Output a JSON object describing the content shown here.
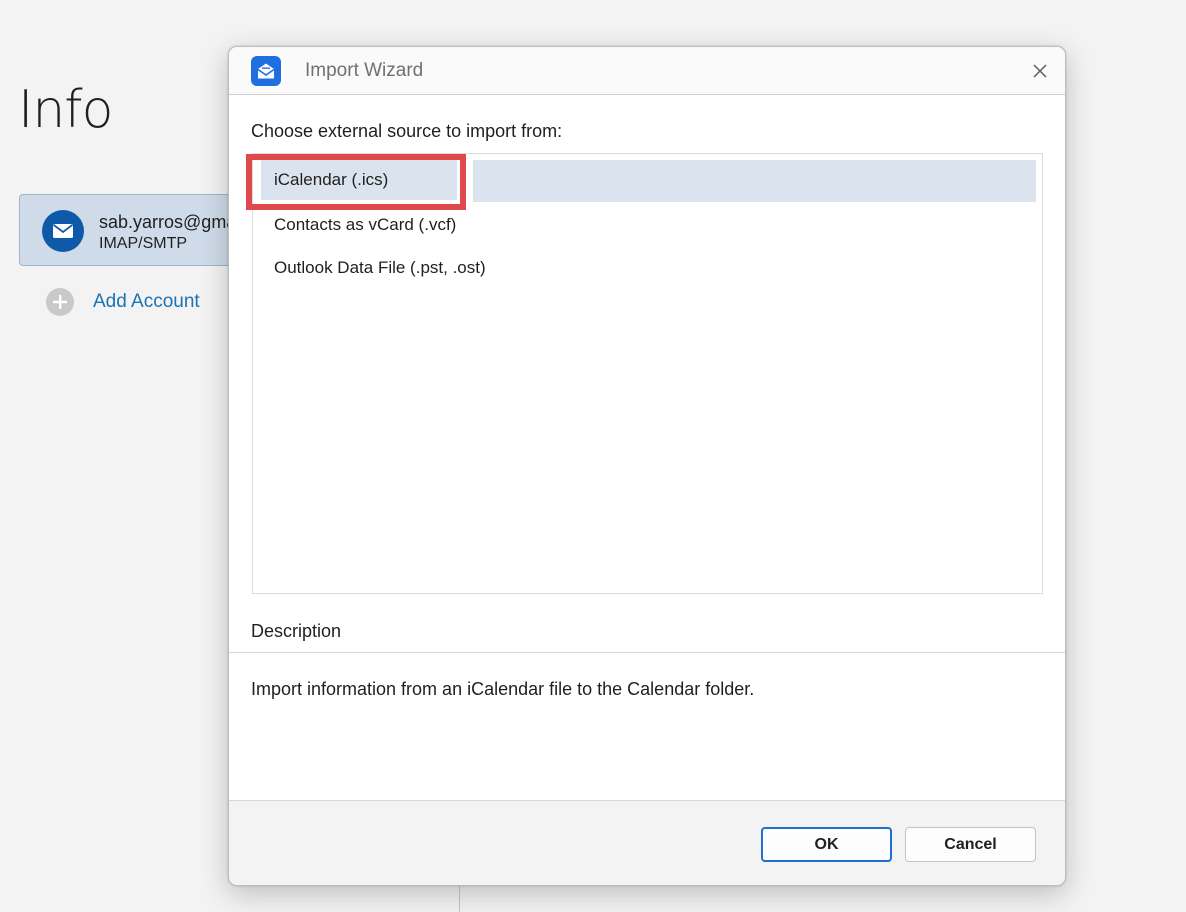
{
  "background": {
    "page_title": "Info",
    "account": {
      "email": "sab.yarros@gmail.com",
      "type": "IMAP/SMTP",
      "avatar_icon": "mail-icon"
    },
    "add_account_label": "Add Account"
  },
  "dialog": {
    "title": "Import Wizard",
    "app_icon": "envelope-open-icon",
    "close_icon": "close-icon",
    "choose_label": "Choose external source to import from:",
    "sources": [
      {
        "label": "iCalendar (.ics)",
        "selected": true
      },
      {
        "label": "Contacts as vCard (.vcf)",
        "selected": false
      },
      {
        "label": "Outlook Data File (.pst, .ost)",
        "selected": false
      }
    ],
    "description_label": "Description",
    "description_text": "Import information from an iCalendar file to the Calendar folder.",
    "ok_label": "OK",
    "cancel_label": "Cancel"
  },
  "colors": {
    "accent": "#1f6fd0",
    "selection": "#dbe4ee",
    "highlight": "#e0494c",
    "link": "#1a73b5"
  }
}
